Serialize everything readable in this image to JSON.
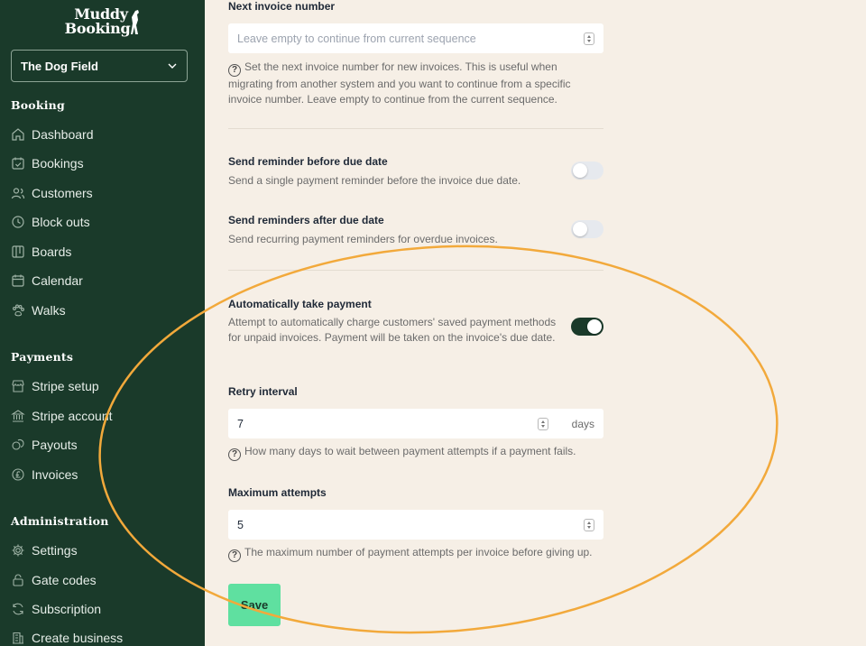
{
  "brand": {
    "line1": "Muddy",
    "line2": "Booking"
  },
  "business_select": {
    "value": "The Dog Field"
  },
  "sections": {
    "booking": "Booking",
    "payments": "Payments",
    "administration": "Administration"
  },
  "nav": {
    "booking": [
      {
        "label": "Dashboard",
        "icon": "home-icon"
      },
      {
        "label": "Bookings",
        "icon": "calendar-check-icon"
      },
      {
        "label": "Customers",
        "icon": "users-icon"
      },
      {
        "label": "Block outs",
        "icon": "clock-icon"
      },
      {
        "label": "Boards",
        "icon": "board-icon"
      },
      {
        "label": "Calendar",
        "icon": "calendar-icon"
      },
      {
        "label": "Walks",
        "icon": "paw-icon"
      }
    ],
    "payments": [
      {
        "label": "Stripe setup",
        "icon": "store-icon"
      },
      {
        "label": "Stripe account",
        "icon": "bank-icon"
      },
      {
        "label": "Payouts",
        "icon": "coins-icon"
      },
      {
        "label": "Invoices",
        "icon": "pound-icon"
      }
    ],
    "administration": [
      {
        "label": "Settings",
        "icon": "gear-icon"
      },
      {
        "label": "Gate codes",
        "icon": "lock-icon"
      },
      {
        "label": "Subscription",
        "icon": "refresh-icon"
      },
      {
        "label": "Create business",
        "icon": "building-icon"
      }
    ]
  },
  "form": {
    "next_invoice": {
      "label": "Next invoice number",
      "placeholder": "Leave empty to continue from current sequence",
      "help": "Set the next invoice number for new invoices. This is useful when migrating from another system and you want to continue from a specific invoice number. Leave empty to continue from the current sequence."
    },
    "reminder_before": {
      "label": "Send reminder before due date",
      "desc": "Send a single payment reminder before the invoice due date.",
      "enabled": false
    },
    "reminder_after": {
      "label": "Send reminders after due date",
      "desc": "Send recurring payment reminders for overdue invoices.",
      "enabled": false
    },
    "auto_payment": {
      "label": "Automatically take payment",
      "desc": "Attempt to automatically charge customers' saved payment methods for unpaid invoices. Payment will be taken on the invoice's due date.",
      "enabled": true
    },
    "retry_interval": {
      "label": "Retry interval",
      "value": "7",
      "suffix": "days",
      "help": "How many days to wait between payment attempts if a payment fails."
    },
    "max_attempts": {
      "label": "Maximum attempts",
      "value": "5",
      "help": "The maximum number of payment attempts per invoice before giving up."
    },
    "save_label": "Save"
  },
  "colors": {
    "sidebar_bg": "#1a3a2a",
    "page_bg": "#f6efe6",
    "accent_green": "#5fe0a0",
    "annotation_orange": "#f2a93b"
  }
}
